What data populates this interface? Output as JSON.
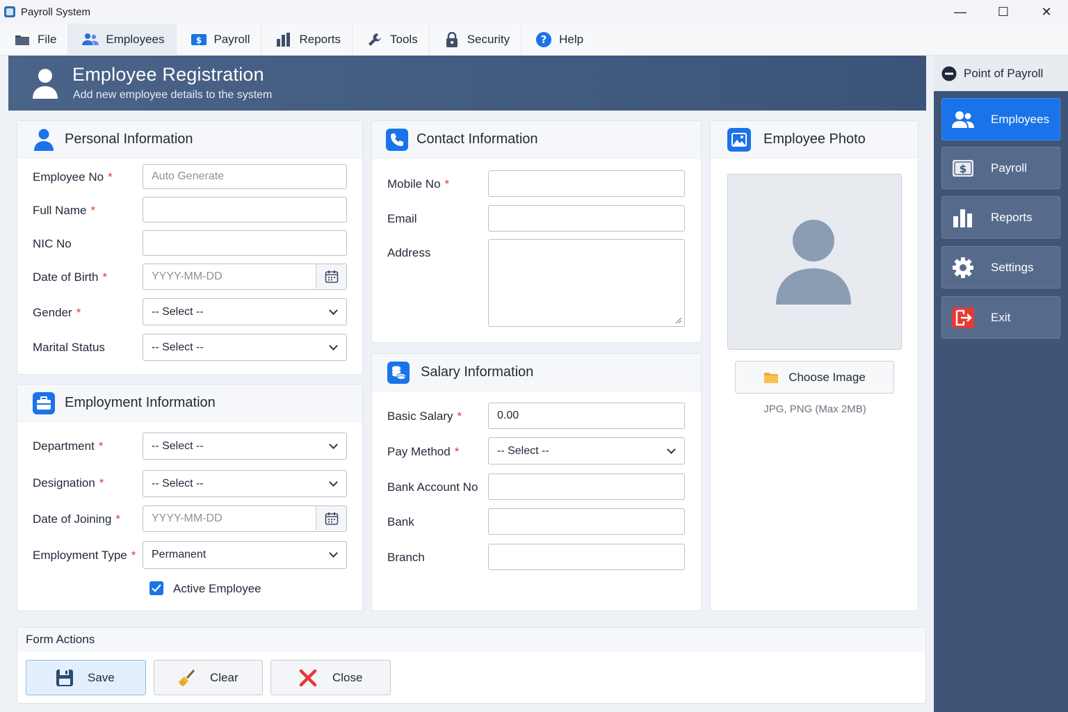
{
  "window": {
    "title": "Payroll System",
    "minimize": "—",
    "maximize": "☐",
    "close": "✕"
  },
  "menu": [
    {
      "label": "File",
      "icon": "folder-icon"
    },
    {
      "label": "Employees",
      "icon": "users-icon",
      "active": true
    },
    {
      "label": "Payroll",
      "icon": "dollar-icon"
    },
    {
      "label": "Reports",
      "icon": "bar-chart-icon"
    },
    {
      "label": "Tools",
      "icon": "wrench-icon"
    },
    {
      "label": "Security",
      "icon": "lock-icon"
    },
    {
      "label": "Help",
      "icon": "help-icon"
    }
  ],
  "banner": {
    "title": "Employee Registration",
    "subtitle": "Add new employee details to the system"
  },
  "personal": {
    "title": "Personal Information",
    "employee_no": {
      "label": "Employee No",
      "placeholder": "Auto Generate"
    },
    "full_name": {
      "label": "Full Name",
      "value": ""
    },
    "nic_no": {
      "label": "NIC No",
      "value": ""
    },
    "dob": {
      "label": "Date of Birth",
      "placeholder": "YYYY-MM-DD"
    },
    "gender": {
      "label": "Gender",
      "value": "-- Select --"
    },
    "marital": {
      "label": "Marital Status",
      "value": "-- Select --"
    }
  },
  "employment": {
    "title": "Employment Information",
    "department": {
      "label": "Department",
      "value": "-- Select --"
    },
    "designation": {
      "label": "Designation",
      "value": "-- Select --"
    },
    "doj": {
      "label": "Date of Joining",
      "placeholder": "YYYY-MM-DD"
    },
    "type": {
      "label": "Employment Type",
      "value": "Permanent"
    },
    "active": {
      "label": "Active Employee",
      "checked": true
    }
  },
  "contact": {
    "title": "Contact Information",
    "mobile": {
      "label": "Mobile No",
      "value": ""
    },
    "email": {
      "label": "Email",
      "value": ""
    },
    "address": {
      "label": "Address",
      "value": ""
    }
  },
  "salary": {
    "title": "Salary Information",
    "basic": {
      "label": "Basic Salary",
      "value": "0.00"
    },
    "pay_method": {
      "label": "Pay Method",
      "value": "-- Select --"
    },
    "account": {
      "label": "Bank Account No",
      "value": ""
    },
    "bank": {
      "label": "Bank",
      "value": ""
    },
    "branch": {
      "label": "Branch",
      "value": ""
    }
  },
  "photo": {
    "title": "Employee Photo",
    "button": "Choose Image",
    "hint": "JPG, PNG (Max 2MB)"
  },
  "sidebar": {
    "title": "Point of Payroll",
    "items": [
      {
        "label": "Employees",
        "icon": "users-icon",
        "active": true
      },
      {
        "label": "Payroll",
        "icon": "dollar-icon"
      },
      {
        "label": "Reports",
        "icon": "bar-chart-icon"
      },
      {
        "label": "Settings",
        "icon": "gear-icon"
      },
      {
        "label": "Exit",
        "icon": "exit-icon"
      }
    ]
  },
  "actions": {
    "title": "Form Actions",
    "save": "Save",
    "clear": "Clear",
    "close": "Close"
  },
  "required_mark": "*",
  "colors": {
    "accent": "#1a73e8",
    "banner": "#445c82",
    "sidebar": "#3f5578",
    "required": "#e53935"
  }
}
